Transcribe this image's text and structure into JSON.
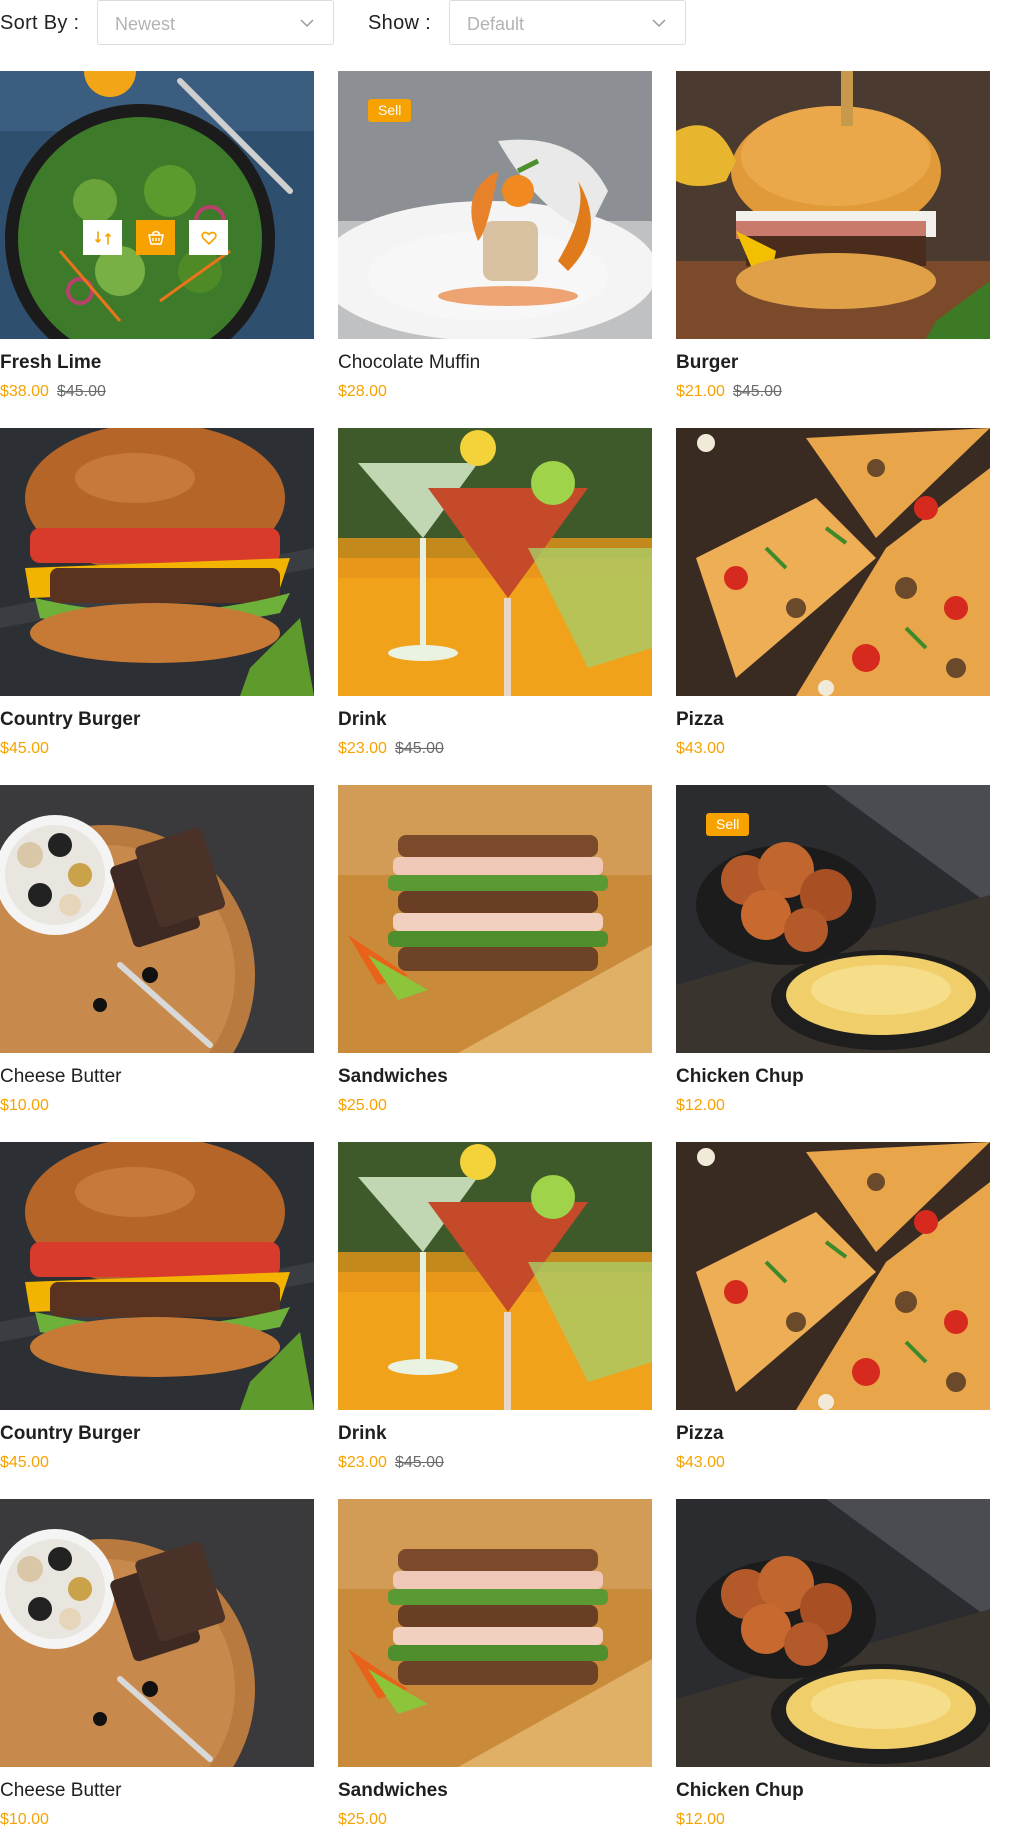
{
  "filters": {
    "sort_label": "Sort By :",
    "sort_value": "Newest",
    "show_label": "Show :",
    "show_value": "Default"
  },
  "colors": {
    "accent": "#f7a200",
    "text": "#1f1f1f",
    "old_price": "#6b6b6b"
  },
  "hover_actions": [
    "compare-icon",
    "cart-icon",
    "heart-icon"
  ],
  "products": [
    {
      "name": "Fresh Lime",
      "price": "$38.00",
      "old_price": "$45.00",
      "badge": "",
      "bold": true,
      "image": "salad"
    },
    {
      "name": "Chocolate Muffin",
      "price": "$28.00",
      "old_price": "",
      "badge": "Sell",
      "bold": false,
      "image": "plate"
    },
    {
      "name": "Burger",
      "price": "$21.00",
      "old_price": "$45.00",
      "badge": "",
      "bold": true,
      "image": "burger-egg"
    },
    {
      "name": "Country Burger",
      "price": "$45.00",
      "old_price": "",
      "badge": "",
      "bold": true,
      "image": "burger"
    },
    {
      "name": "Drink",
      "price": "$23.00",
      "old_price": "$45.00",
      "badge": "",
      "bold": true,
      "image": "drink"
    },
    {
      "name": "Pizza",
      "price": "$43.00",
      "old_price": "",
      "badge": "",
      "bold": true,
      "image": "pizza"
    },
    {
      "name": "Cheese Butter",
      "price": "$10.00",
      "old_price": "",
      "badge": "",
      "bold": false,
      "image": "cheese"
    },
    {
      "name": "Sandwiches",
      "price": "$25.00",
      "old_price": "",
      "badge": "",
      "bold": true,
      "image": "sandwich"
    },
    {
      "name": "Chicken Chup",
      "price": "$12.00",
      "old_price": "",
      "badge": "Sell",
      "bold": true,
      "image": "chicken"
    },
    {
      "name": "Country Burger",
      "price": "$45.00",
      "old_price": "",
      "badge": "",
      "bold": true,
      "image": "burger"
    },
    {
      "name": "Drink",
      "price": "$23.00",
      "old_price": "$45.00",
      "badge": "",
      "bold": true,
      "image": "drink"
    },
    {
      "name": "Pizza",
      "price": "$43.00",
      "old_price": "",
      "badge": "",
      "bold": true,
      "image": "pizza"
    },
    {
      "name": "Cheese Butter",
      "price": "$10.00",
      "old_price": "",
      "badge": "",
      "bold": false,
      "image": "cheese"
    },
    {
      "name": "Sandwiches",
      "price": "$25.00",
      "old_price": "",
      "badge": "",
      "bold": true,
      "image": "sandwich"
    },
    {
      "name": "Chicken Chup",
      "price": "$12.00",
      "old_price": "",
      "badge": "",
      "bold": true,
      "image": "chicken"
    }
  ]
}
